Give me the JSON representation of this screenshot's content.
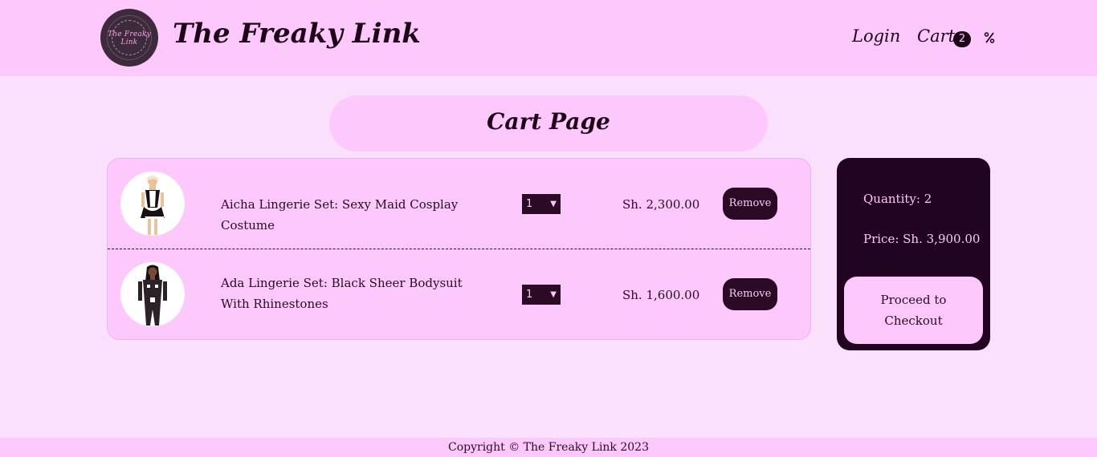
{
  "header": {
    "logo_text": "The Freaky Link",
    "brand": "The Freaky Link",
    "nav": {
      "login_label": "Login",
      "cart_label": "Cart",
      "cart_count": "2",
      "menu_icon": "percent-icon"
    }
  },
  "page": {
    "title": "Cart Page"
  },
  "cart": {
    "items": [
      {
        "name": "Aicha Lingerie Set: Sexy Maid Cosplay Costume",
        "quantity": "1",
        "price": "Sh. 2,300.00",
        "remove_label": "Remove",
        "image_icon": "product-photo-maid"
      },
      {
        "name": "Ada Lingerie Set: Black Sheer Bodysuit With Rhinestones",
        "quantity": "1",
        "price": "Sh. 1,600.00",
        "remove_label": "Remove",
        "image_icon": "product-photo-bodysuit"
      }
    ]
  },
  "summary": {
    "quantity_text": "Quantity: 2",
    "price_text": "Price: Sh. 3,900.00",
    "checkout_label": "Proceed to Checkout"
  },
  "footer": {
    "copyright": "Copyright © The Freaky Link 2023"
  },
  "colors": {
    "header_bg": "#fdc8fc",
    "page_bg": "#fbe0fb",
    "dark_accent": "#220420",
    "text": "#2a0a24"
  }
}
